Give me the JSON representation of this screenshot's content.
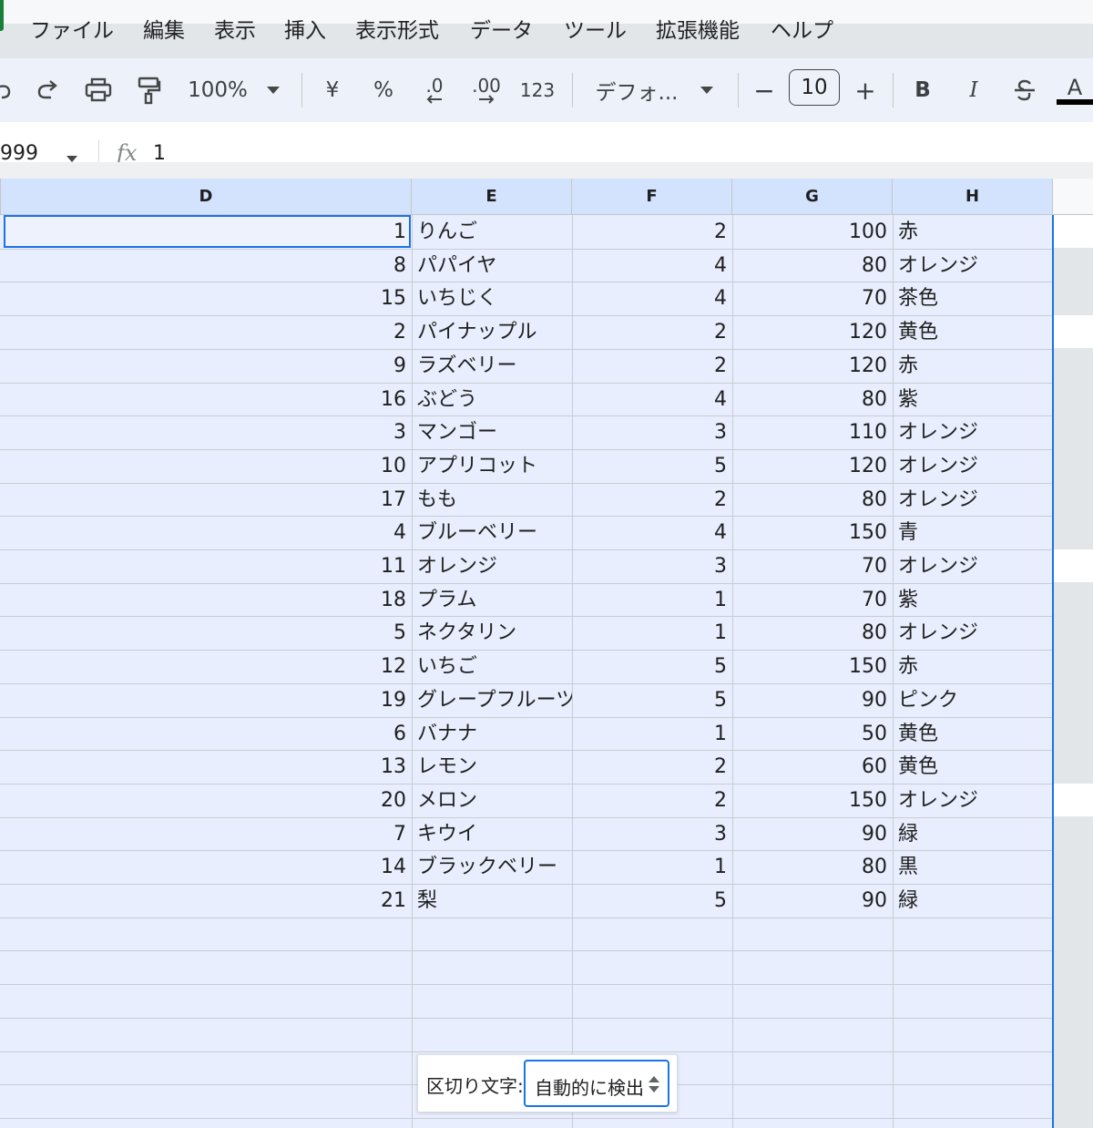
{
  "menu": {
    "items": [
      "ファイル",
      "編集",
      "表示",
      "挿入",
      "表示形式",
      "データ",
      "ツール",
      "拡張機能",
      "ヘルプ"
    ]
  },
  "toolbar": {
    "zoom": "100%",
    "currency": "¥",
    "percent": "%",
    "decrease_decimal": ".0",
    "increase_decimal": ".00",
    "number_format": "123",
    "font": "デフォ...",
    "font_size": "10",
    "minus": "−",
    "plus": "+",
    "bold": "B",
    "italic": "I",
    "text_color": "A"
  },
  "formula_bar": {
    "name_box": "999",
    "fx": "fx",
    "value": "1"
  },
  "columns": [
    "D",
    "E",
    "F",
    "G",
    "H"
  ],
  "rows": [
    {
      "d": "1",
      "e": "りんご",
      "f": "2",
      "g": "100",
      "h": "赤"
    },
    {
      "d": "8",
      "e": "パパイヤ",
      "f": "4",
      "g": "80",
      "h": "オレンジ"
    },
    {
      "d": "15",
      "e": "いちじく",
      "f": "4",
      "g": "70",
      "h": "茶色"
    },
    {
      "d": "2",
      "e": "パイナップル",
      "f": "2",
      "g": "120",
      "h": "黄色"
    },
    {
      "d": "9",
      "e": "ラズベリー",
      "f": "2",
      "g": "120",
      "h": "赤"
    },
    {
      "d": "16",
      "e": "ぶどう",
      "f": "4",
      "g": "80",
      "h": "紫"
    },
    {
      "d": "3",
      "e": "マンゴー",
      "f": "3",
      "g": "110",
      "h": "オレンジ"
    },
    {
      "d": "10",
      "e": "アプリコット",
      "f": "5",
      "g": "120",
      "h": "オレンジ"
    },
    {
      "d": "17",
      "e": "もも",
      "f": "2",
      "g": "80",
      "h": "オレンジ"
    },
    {
      "d": "4",
      "e": "ブルーベリー",
      "f": "4",
      "g": "150",
      "h": "青"
    },
    {
      "d": "11",
      "e": "オレンジ",
      "f": "3",
      "g": "70",
      "h": "オレンジ"
    },
    {
      "d": "18",
      "e": "プラム",
      "f": "1",
      "g": "70",
      "h": "紫"
    },
    {
      "d": "5",
      "e": "ネクタリン",
      "f": "1",
      "g": "80",
      "h": "オレンジ"
    },
    {
      "d": "12",
      "e": "いちご",
      "f": "5",
      "g": "150",
      "h": "赤"
    },
    {
      "d": "19",
      "e": "グレープフルーツ",
      "f": "5",
      "g": "90",
      "h": "ピンク"
    },
    {
      "d": "6",
      "e": "バナナ",
      "f": "1",
      "g": "50",
      "h": "黄色"
    },
    {
      "d": "13",
      "e": "レモン",
      "f": "2",
      "g": "60",
      "h": "黄色"
    },
    {
      "d": "20",
      "e": "メロン",
      "f": "2",
      "g": "150",
      "h": "オレンジ"
    },
    {
      "d": "7",
      "e": "キウイ",
      "f": "3",
      "g": "90",
      "h": "緑"
    },
    {
      "d": "14",
      "e": "ブラックベリー",
      "f": "1",
      "g": "80",
      "h": "黒"
    },
    {
      "d": "21",
      "e": "梨",
      "f": "5",
      "g": "90",
      "h": "緑"
    }
  ],
  "delimiter": {
    "label": "区切り文字:",
    "value": "自動的に検出"
  },
  "colors": {
    "accent": "#1a73e8",
    "selection": "#e8eefd",
    "header_selected": "#d3e3fd"
  }
}
